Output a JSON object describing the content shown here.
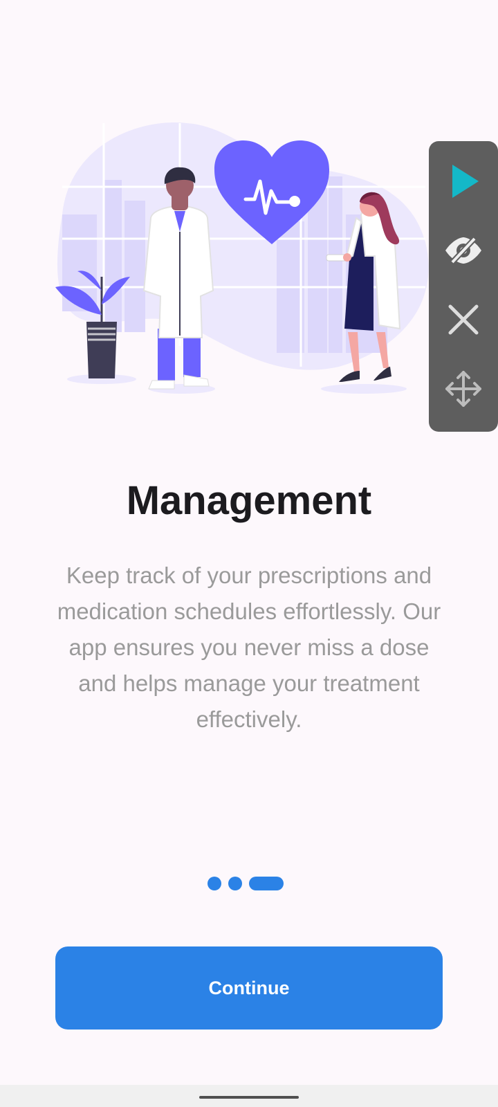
{
  "onboarding": {
    "title": "Management",
    "description": "Keep track of your prescriptions and medication schedules effortlessly. Our app ensures you never miss a dose and helps manage your treatment effectively.",
    "page_indicator": {
      "pages": 3,
      "current": 3
    },
    "continue_label": "Continue"
  },
  "overlay_toolbar": {
    "icons": [
      "play-icon",
      "eye-off-icon",
      "close-icon",
      "move-icon"
    ]
  },
  "colors": {
    "accent": "#2b82e6",
    "illustration_primary": "#6c63ff",
    "background": "#fdf8fc"
  }
}
